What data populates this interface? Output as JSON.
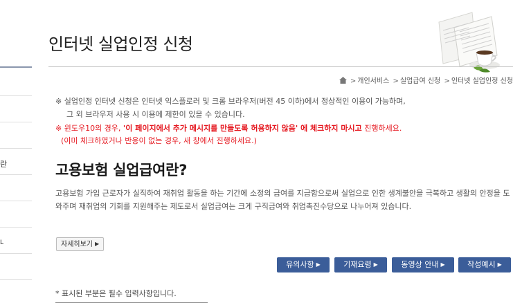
{
  "page": {
    "title": "인터넷 실업인정 신청"
  },
  "sidebar": {
    "fragments": [
      "란",
      "L"
    ]
  },
  "breadcrumb": {
    "items": [
      "개인서비스",
      "실업급여 신청",
      "인터넷 실업인정 신청"
    ],
    "separator": ">"
  },
  "notices": {
    "line1": "※ 실업인정 인터넷 신청은 인터넷 익스플로러 및 크롬 브라우저(버전 45 이하)에서 정상적인 이용이 가능하며,",
    "line2": "그 외 브라우저 사용 시 이용에 제한이 있을 수 있습니다.",
    "line3_prefix": "※ 윈도우10의 경우, ",
    "line3_bold": "'이 페이지에서 추가 메시지를 만들도록 허용하지 않음' 에 체크하지 마시고",
    "line3_suffix": " 진행하세요.",
    "line4": "(이미 체크하였거나 반응이 없는 경우, 새 창에서 진행하세요.)"
  },
  "section": {
    "title": "고용보험 실업급여란?",
    "description": "고용보험 가입 근로자가 실직하여 재취업 활동을 하는 기간에 소정의 급여를 지급함으로써 실업으로 인한 생계불안을 극복하고 생활의 안정을 도와주며 재취업의 기회를 지원해주는 제도로서 실업급여는 크게 구직급여와 취업촉진수당으로 나누어져 있습니다.",
    "detail_button": "자세히보기"
  },
  "actions": {
    "notes": "유의사항",
    "guide": "기재요령",
    "video": "동영상 안내",
    "example": "작성예시",
    "arrow": "▶"
  },
  "form": {
    "required_note": "* 표시된 부분은 필수 입력사항입니다."
  },
  "colors": {
    "primary_button": "#3b5d99",
    "warning_text": "#e5171f"
  },
  "icons": [
    "home-icon",
    "book-coffee-illustration"
  ]
}
